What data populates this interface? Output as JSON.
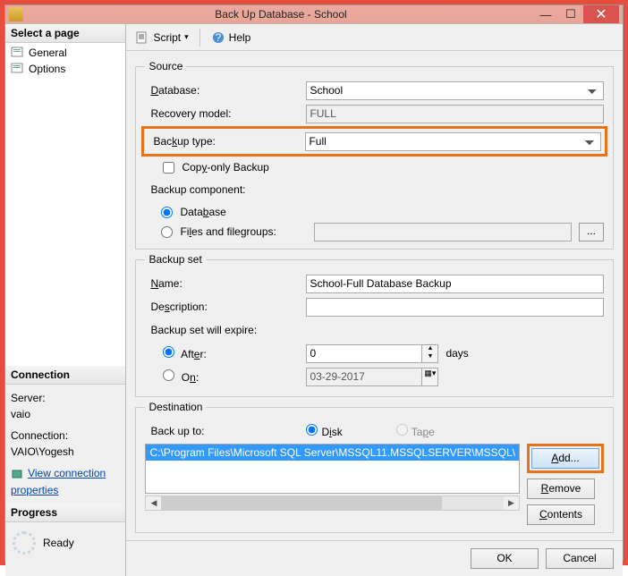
{
  "window": {
    "title": "Back Up Database - School"
  },
  "sidebar": {
    "select_page_header": "Select a page",
    "pages": [
      {
        "label": "General"
      },
      {
        "label": "Options"
      }
    ],
    "connection_header": "Connection",
    "server_label": "Server:",
    "server_value": "vaio",
    "connection_label": "Connection:",
    "connection_value": "VAIO\\Yogesh",
    "view_props": "View connection properties",
    "progress_header": "Progress",
    "progress_status": "Ready"
  },
  "toolbar": {
    "script_label": "Script",
    "help_label": "Help"
  },
  "source": {
    "legend": "Source",
    "database_label": "Database:",
    "database_value": "School",
    "recovery_label": "Recovery model:",
    "recovery_value": "FULL",
    "backup_type_label": "Backup type:",
    "backup_type_value": "Full",
    "copy_only_label": "Copy-only Backup",
    "component_label": "Backup component:",
    "radio_database": "Database",
    "radio_files": "Files and filegroups:"
  },
  "backup_set": {
    "legend": "Backup set",
    "name_label": "Name:",
    "name_value": "School-Full Database Backup",
    "description_label": "Description:",
    "description_value": "",
    "expire_label": "Backup set will expire:",
    "after_label": "After:",
    "after_value": "0",
    "days_label": "days",
    "on_label": "On:",
    "on_value": "03-29-2017"
  },
  "destination": {
    "legend": "Destination",
    "backup_to_label": "Back up to:",
    "radio_disk": "Disk",
    "radio_tape": "Tape",
    "path": "C:\\Program Files\\Microsoft SQL Server\\MSSQL11.MSSQLSERVER\\MSSQL\\",
    "add_btn": "Add...",
    "remove_btn": "Remove",
    "contents_btn": "Contents"
  },
  "footer": {
    "ok": "OK",
    "cancel": "Cancel"
  }
}
